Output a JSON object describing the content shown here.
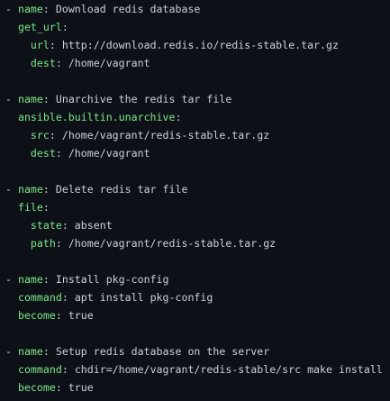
{
  "code": {
    "lines": [
      {
        "prefix": "- ",
        "key": "name",
        "value": "Download redis database"
      },
      {
        "prefix": "  ",
        "key": "get_url",
        "value": ""
      },
      {
        "prefix": "    ",
        "key": "url",
        "value": "http://download.redis.io/redis-stable.tar.gz"
      },
      {
        "prefix": "    ",
        "key": "dest",
        "value": "/home/vagrant"
      },
      {
        "prefix": "",
        "key": "",
        "value": ""
      },
      {
        "prefix": "- ",
        "key": "name",
        "value": "Unarchive the redis tar file"
      },
      {
        "prefix": "  ",
        "key": "ansible.builtin.unarchive",
        "value": ""
      },
      {
        "prefix": "    ",
        "key": "src",
        "value": "/home/vagrant/redis-stable.tar.gz"
      },
      {
        "prefix": "    ",
        "key": "dest",
        "value": "/home/vagrant"
      },
      {
        "prefix": "",
        "key": "",
        "value": ""
      },
      {
        "prefix": "- ",
        "key": "name",
        "value": "Delete redis tar file"
      },
      {
        "prefix": "  ",
        "key": "file",
        "value": ""
      },
      {
        "prefix": "    ",
        "key": "state",
        "value": "absent"
      },
      {
        "prefix": "    ",
        "key": "path",
        "value": "/home/vagrant/redis-stable.tar.gz"
      },
      {
        "prefix": "",
        "key": "",
        "value": ""
      },
      {
        "prefix": "- ",
        "key": "name",
        "value": "Install pkg-config"
      },
      {
        "prefix": "  ",
        "key": "command",
        "value": "apt install pkg-config"
      },
      {
        "prefix": "  ",
        "key": "become",
        "value": "true"
      },
      {
        "prefix": "",
        "key": "",
        "value": ""
      },
      {
        "prefix": "- ",
        "key": "name",
        "value": "Setup redis database on the server"
      },
      {
        "prefix": "  ",
        "key": "command",
        "value": "chdir=/home/vagrant/redis-stable/src make install"
      },
      {
        "prefix": "  ",
        "key": "become",
        "value": "true"
      }
    ]
  },
  "colors": {
    "background": "#0d1117",
    "key": "#7ee787",
    "text": "#c9d1d9"
  }
}
